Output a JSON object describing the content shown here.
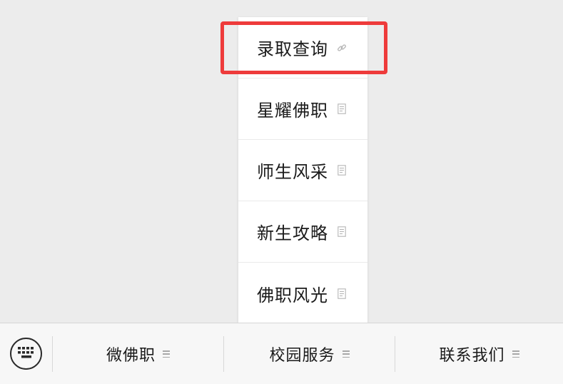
{
  "popup": {
    "items": [
      {
        "label": "录取查询",
        "icon": "link-icon"
      },
      {
        "label": "星耀佛职",
        "icon": "document-icon"
      },
      {
        "label": "师生风采",
        "icon": "document-icon"
      },
      {
        "label": "新生攻略",
        "icon": "document-icon"
      },
      {
        "label": "佛职风光",
        "icon": "document-icon"
      }
    ]
  },
  "menubar": {
    "keyboard_icon": "keyboard-icon",
    "tabs": [
      {
        "label": "微佛职",
        "icon": "submenu-icon"
      },
      {
        "label": "校园服务",
        "icon": "submenu-icon"
      },
      {
        "label": "联系我们",
        "icon": "submenu-icon"
      }
    ]
  },
  "colors": {
    "background": "#ececec",
    "highlight": "#ee3b3b",
    "menubar": "#f7f7f7"
  }
}
